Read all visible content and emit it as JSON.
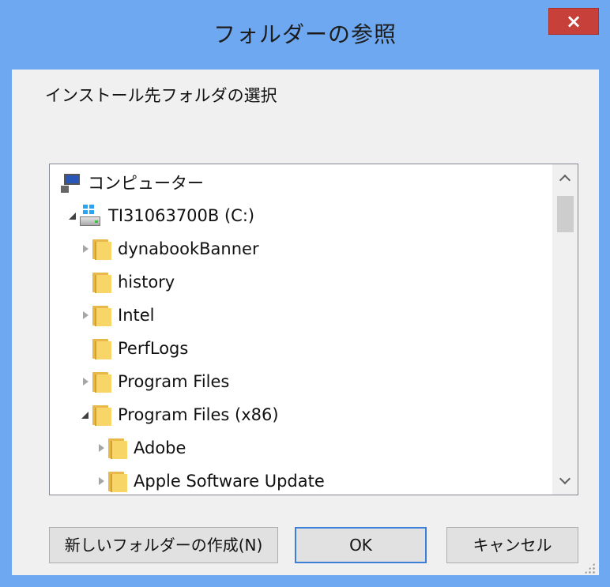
{
  "window": {
    "title": "フォルダーの参照",
    "close_label": "×"
  },
  "prompt": "インストール先フォルダの選択",
  "tree": {
    "items": [
      {
        "label": "コンピューター",
        "icon": "computer-icon",
        "expander": "none"
      },
      {
        "label": "TI31063700B (C:)",
        "icon": "drive-icon",
        "expander": "expanded"
      },
      {
        "label": "dynabookBanner",
        "icon": "folder-icon",
        "expander": "collapsed"
      },
      {
        "label": "history",
        "icon": "folder-icon",
        "expander": "none"
      },
      {
        "label": "Intel",
        "icon": "folder-icon",
        "expander": "collapsed"
      },
      {
        "label": "PerfLogs",
        "icon": "folder-icon",
        "expander": "none"
      },
      {
        "label": "Program Files",
        "icon": "folder-icon",
        "expander": "collapsed"
      },
      {
        "label": "Program Files (x86)",
        "icon": "folder-icon",
        "expander": "expanded"
      },
      {
        "label": "Adobe",
        "icon": "folder-icon",
        "expander": "collapsed"
      },
      {
        "label": "Apple Software Update",
        "icon": "folder-icon",
        "expander": "collapsed"
      }
    ]
  },
  "buttons": {
    "new_folder": "新しいフォルダーの作成(N)",
    "ok": "OK",
    "cancel": "キャンセル"
  },
  "colors": {
    "title_bar": "#6ea8f0",
    "close_button": "#c8403a",
    "default_button_border": "#3c7fd9"
  }
}
